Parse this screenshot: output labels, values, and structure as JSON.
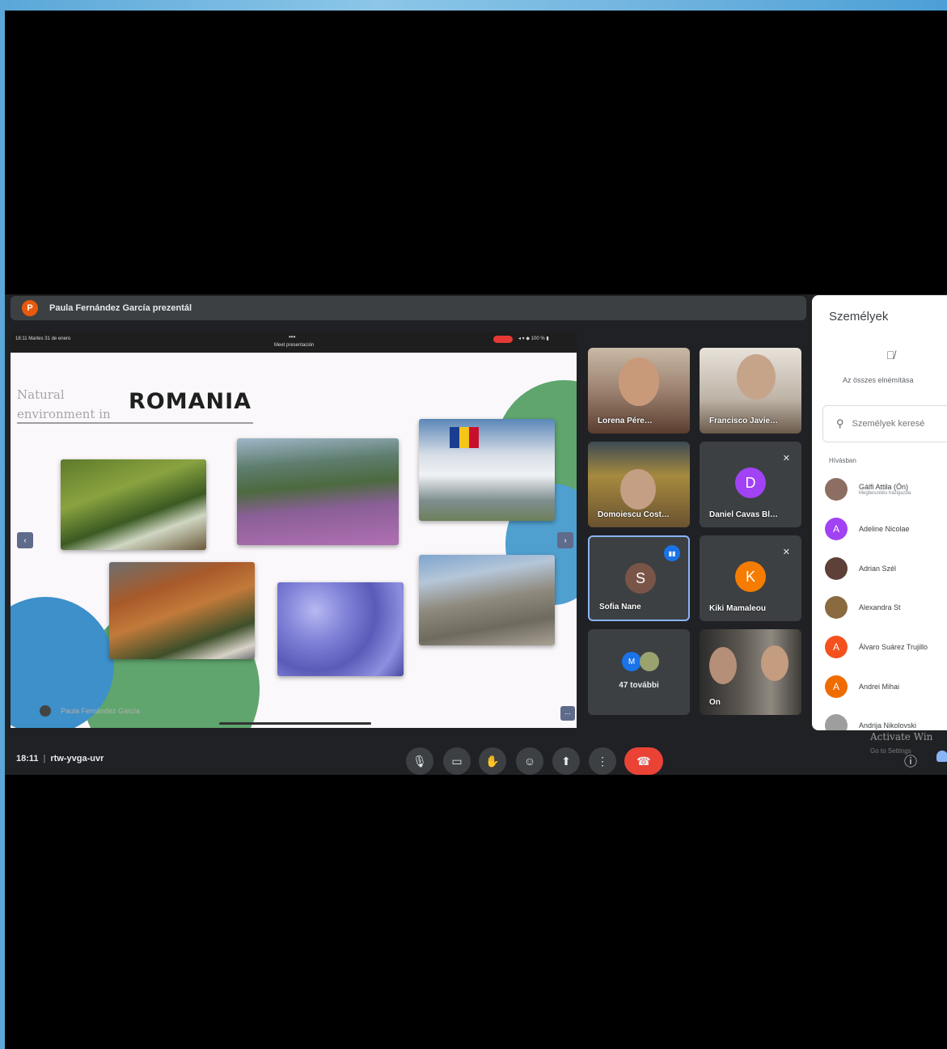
{
  "presenter": {
    "initial": "P",
    "text": "Paula Fernández García prezentál"
  },
  "slide": {
    "status_time": "18:11  Martes 31 de enero",
    "status_dots": "•••",
    "status_center": "Meet presentación",
    "status_right": "◂ ▾ ◆ 100 % ▮",
    "title_small_line1": "Natural",
    "title_small_line2": "environment in",
    "title_big": "ROMANIA",
    "author": "Paula Fernández García",
    "nav_left": "‹",
    "nav_right": "›",
    "more": "⋯"
  },
  "tiles": {
    "t1": {
      "name": "Lorena Pére…"
    },
    "t2": {
      "name": "Francisco Javie…"
    },
    "t3": {
      "name": "Domoiescu Cost…"
    },
    "t4": {
      "name": "Daniel Cavas Bl…",
      "initial": "D",
      "color": "#a142f4"
    },
    "t5": {
      "name": "Sofia Nane",
      "initial": "S",
      "color": "#795548"
    },
    "t6": {
      "name": "Kiki Mamaleou",
      "initial": "K",
      "color": "#f57c00"
    },
    "t7": {
      "name": "47 további",
      "initial": "M"
    },
    "t8": {
      "name": "Ön"
    }
  },
  "people_panel": {
    "title": "Személyek",
    "mute_all": "Az összes elnémítása",
    "search_placeholder": "Személyek keresé",
    "section": "Hívásban",
    "people": [
      {
        "name": "Gálfi Attila (Ön)",
        "sub": "Megbeszélés házigazda",
        "initial": "",
        "color": "#8d6e63"
      },
      {
        "name": "Adeline Nicolae",
        "sub": "",
        "initial": "A",
        "color": "#a142f4"
      },
      {
        "name": "Adrian Szél",
        "sub": "",
        "initial": "",
        "color": "#5d4037"
      },
      {
        "name": "Alexandra St",
        "sub": "",
        "initial": "",
        "color": "#6d4c41"
      },
      {
        "name": "Álvaro Suárez Trujillo",
        "sub": "",
        "initial": "A",
        "color": "#f4511e"
      },
      {
        "name": "Andrei Mihai",
        "sub": "",
        "initial": "A",
        "color": "#ef6c00"
      },
      {
        "name": "Andrija Nikolovski",
        "sub": "",
        "initial": "",
        "color": "#9e9e9e"
      }
    ]
  },
  "bottom": {
    "time": "18:11",
    "meeting_code": "rtw-yvga-uvr",
    "activate": "Activate Win",
    "activate_sub": "Go to Settings"
  },
  "controls": {
    "mic": "🎙",
    "camera": "▭",
    "hand": "✋",
    "emoji": "☺",
    "present": "⬆",
    "more": "⋮",
    "end": "☎",
    "info": "ⓘ"
  }
}
